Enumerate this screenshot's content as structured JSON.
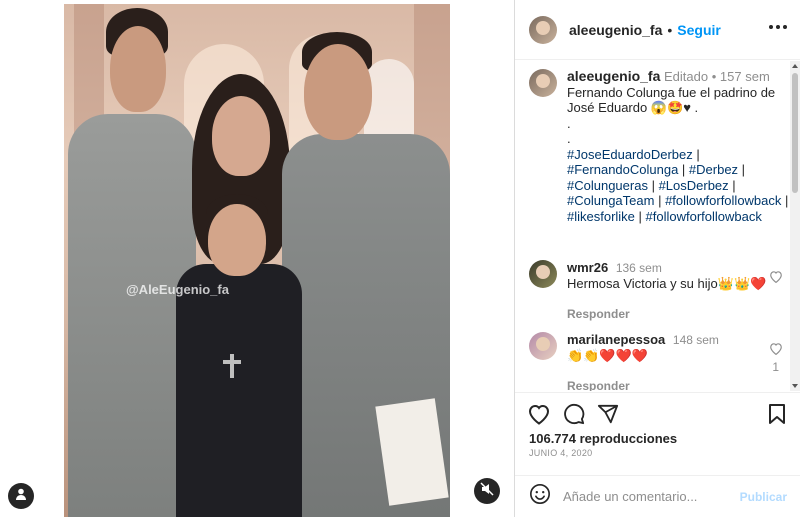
{
  "post": {
    "author": "aleeugenio_fa",
    "follow_label": "Seguir",
    "separator": "•",
    "watermark": "@AleEugenio_fa",
    "caption": {
      "author": "aleeugenio_fa",
      "edited": "Editado",
      "time_sep": "•",
      "time": "157 sem",
      "line1": "Fernando Colunga fue el padrino de",
      "line2": "José Eduardo 😱🤩♥ .",
      "dot1": ".",
      "dot2": ".",
      "tags": [
        "#JoseEduardoDerbez",
        "#FernandoColunga",
        "#Derbez",
        "#Colungueras",
        "#LosDerbez",
        "#ColungaTeam",
        "#followforfollowback",
        "#likesforlike",
        "#followforfollowback"
      ],
      "tag_sep": " | "
    },
    "comments": [
      {
        "user": "wmr26",
        "time": "136 sem",
        "text": "Hermosa Victoria y su hijo👑👑❤️",
        "reply": "Responder"
      },
      {
        "user": "marilanepessoa",
        "time": "148 sem",
        "text": "👏👏❤️❤️❤️",
        "reply": "Responder",
        "likes": "1"
      }
    ],
    "likes_text": "106.774 reproducciones",
    "date": "JUNIO 4, 2020",
    "add_comment_placeholder": "Añade un comentario...",
    "publish_label": "Publicar"
  },
  "icons": {
    "heart": "heart-icon",
    "comment": "comment-icon",
    "share": "share-icon",
    "bookmark": "bookmark-icon",
    "emoji": "emoji-icon",
    "user": "user-icon",
    "mute": "mute-icon",
    "more": "more-icon"
  },
  "colors": {
    "link": "#0095f6",
    "hashtag": "#00376b",
    "muted": "#8e8e8e",
    "publish_disabled": "#b3dbff"
  }
}
